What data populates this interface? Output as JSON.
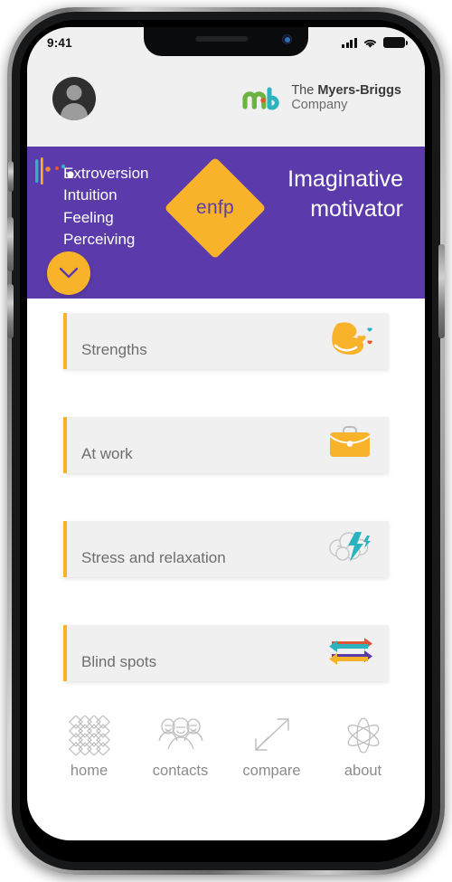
{
  "status_bar": {
    "time": "9:41",
    "signal_icon": "cellular-signal-icon",
    "wifi_icon": "wifi-icon",
    "battery_icon": "battery-icon"
  },
  "header": {
    "avatar_icon": "user-avatar-icon",
    "brand_line1_prefix": "The ",
    "brand_line1_bold": "Myers-Briggs",
    "brand_line2": "Company",
    "logo_icon": "myers-briggs-mb-logo-icon"
  },
  "hero": {
    "traits": [
      "Extroversion",
      "Intuition",
      "Feeling",
      "Perceiving"
    ],
    "type_code": "enfp",
    "title": "Imaginative motivator",
    "expand_icon": "chevron-down-icon",
    "background_color": "#5b3bab",
    "accent_color": "#f8b32b"
  },
  "cards": [
    {
      "label": "Strengths",
      "icon": "flexed-bicep-icon"
    },
    {
      "label": "At work",
      "icon": "briefcase-icon"
    },
    {
      "label": "Stress and relaxation",
      "icon": "cloud-lightning-icon"
    },
    {
      "label": "Blind spots",
      "icon": "four-arrows-icon"
    }
  ],
  "bottom_nav": [
    {
      "label": "home",
      "icon": "lattice-grid-icon"
    },
    {
      "label": "contacts",
      "icon": "people-group-icon"
    },
    {
      "label": "compare",
      "icon": "diagonal-arrows-icon"
    },
    {
      "label": "about",
      "icon": "atom-icon"
    }
  ]
}
